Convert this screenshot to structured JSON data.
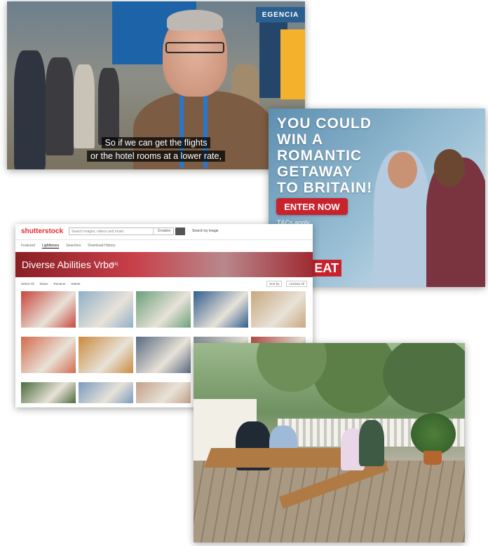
{
  "video": {
    "booth_sign": "EGENCIA",
    "subtitle_line1": "So if we can get the flights",
    "subtitle_line2": "or the hotel rooms at a lower rate,"
  },
  "ad": {
    "headline": [
      "YOU COULD",
      "WIN A",
      "ROMANTIC",
      "GETAWAY",
      "TO BRITAIN!"
    ],
    "button_label": "ENTER NOW",
    "terms": "T&Cs apply",
    "brand_fragment": "EAT",
    "accent_color": "#c8222c"
  },
  "stock_site": {
    "logo": "shutterstock",
    "search_placeholder": "Search images, videos and music",
    "search_scope": "Creative",
    "search_by_image": "Search by image",
    "tabs": [
      "Featured",
      "Lightboxes",
      "Searches",
      "Download History"
    ],
    "active_tab": "Lightboxes",
    "lightbox_title": "Diverse Abilities Vrbo",
    "lightbox_count": "(24)",
    "toolbar": [
      "Select All",
      "Share",
      "Rename",
      "Delete"
    ],
    "toolbar_right": [
      "Sort by",
      "License All"
    ],
    "thumbnail_colors": [
      [
        "#c9453c",
        "#8fb0c8",
        "#6aa07a",
        "#2f5e8e",
        "#c9a77e"
      ],
      [
        "#d36a4c",
        "#c98a3e",
        "#596a80",
        "#7d8a93",
        "#b0463e"
      ],
      [
        "#4a6b3b",
        "#7a9ac0",
        "#c4a088",
        "#6e8a5a",
        "#9a6a4e"
      ]
    ]
  },
  "patio": {
    "description_colors": [
      "#5c7f47",
      "#b07a44",
      "#a99982"
    ]
  }
}
